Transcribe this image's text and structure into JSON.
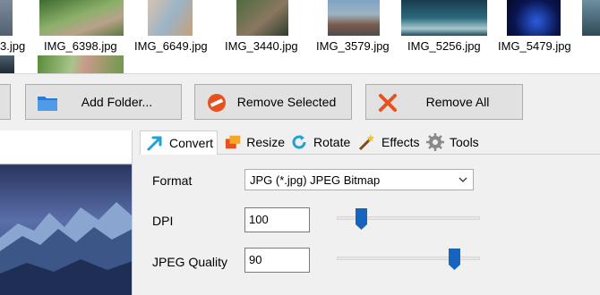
{
  "thumbnails": {
    "captions": [
      "3.jpg",
      "IMG_6398.jpg",
      "IMG_6649.jpg",
      "IMG_3440.jpg",
      "IMG_3579.jpg",
      "IMG_5256.jpg",
      "IMG_5479.jpg"
    ]
  },
  "toolbar": {
    "add_folder_label": "Add Folder...",
    "remove_selected_label": "Remove Selected",
    "remove_all_label": "Remove All"
  },
  "tabs": [
    {
      "label": "Convert",
      "icon": "convert-arrow-icon",
      "active": true
    },
    {
      "label": "Resize",
      "icon": "resize-icon",
      "active": false
    },
    {
      "label": "Rotate",
      "icon": "rotate-icon",
      "active": false
    },
    {
      "label": "Effects",
      "icon": "effects-wand-icon",
      "active": false
    },
    {
      "label": "Tools",
      "icon": "tools-gear-icon",
      "active": false
    }
  ],
  "convert": {
    "format_label": "Format",
    "format_value": "JPG (*.jpg) JPEG Bitmap",
    "dpi_label": "DPI",
    "dpi_value": "100",
    "dpi_slider_fraction": 0.14,
    "quality_label": "JPEG Quality",
    "quality_value": "90",
    "quality_slider_fraction": 0.85
  },
  "colors": {
    "accent": "#1565c0",
    "remove_selected": "#e8511f",
    "remove_all": "#e8511f",
    "folder": "#2b7bd6"
  }
}
